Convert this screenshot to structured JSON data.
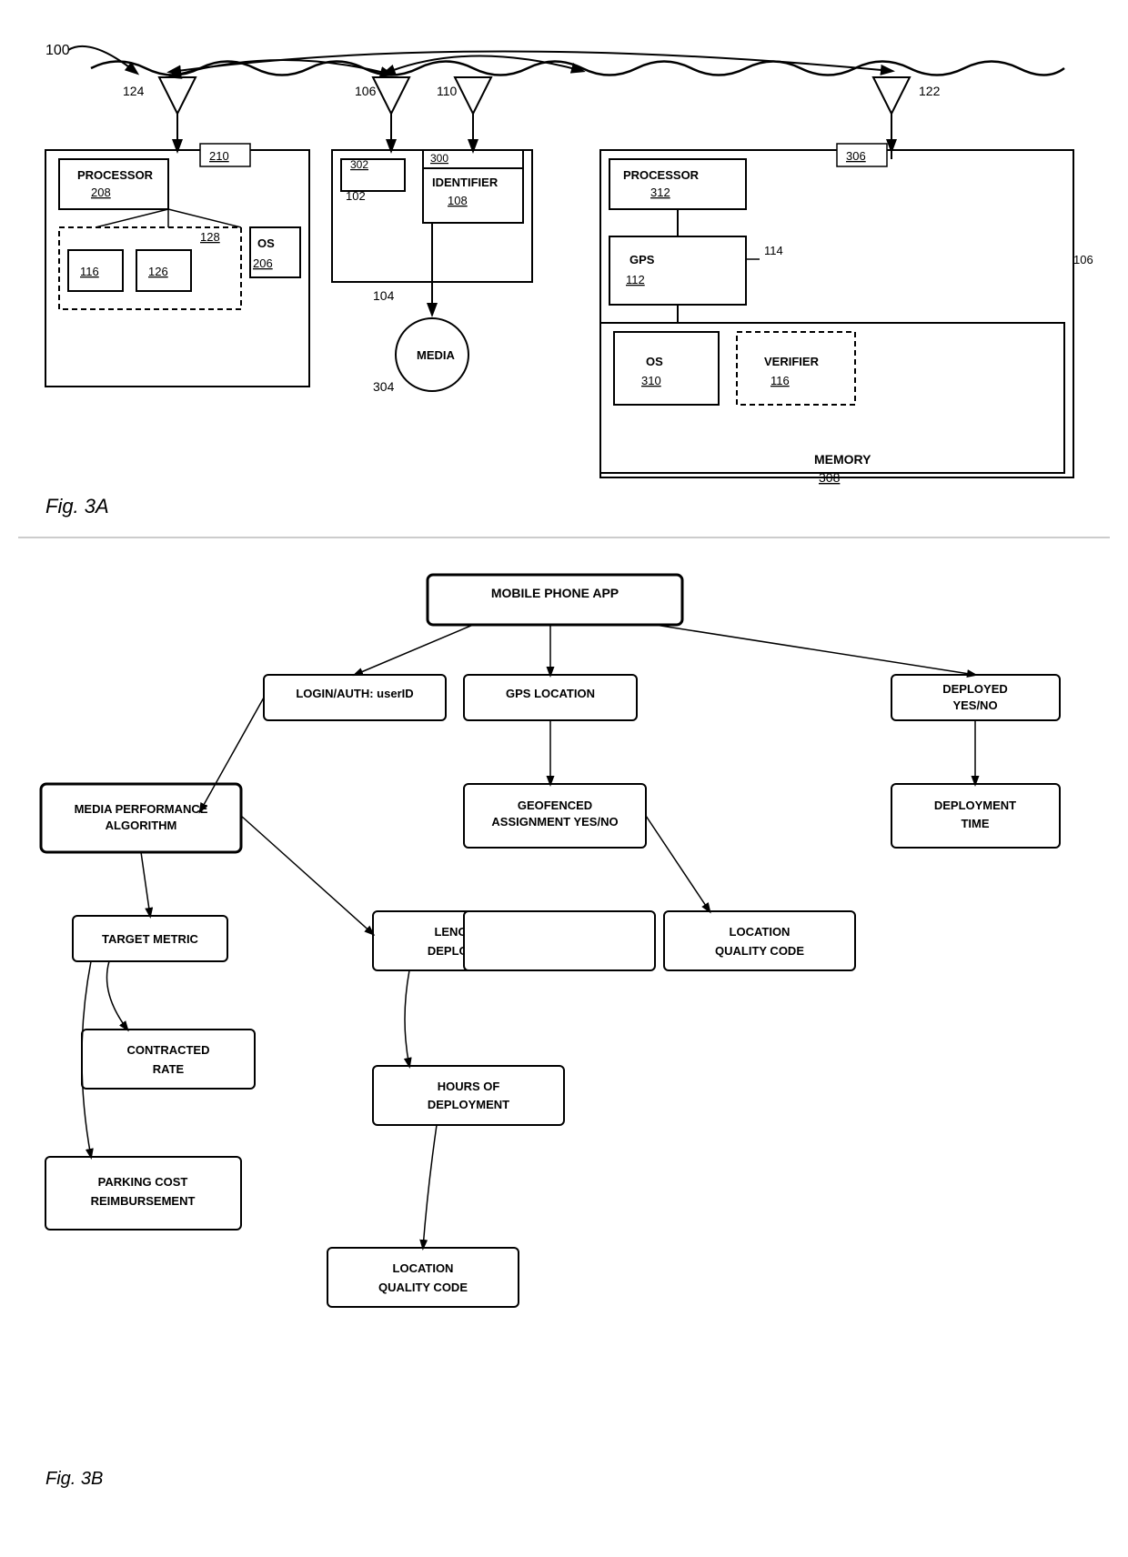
{
  "fig3a": {
    "label": "Fig. 3A",
    "ref_100": "100",
    "left_device": {
      "antenna_label": "124",
      "box_label": "210",
      "processor_label": "PROCESSOR",
      "processor_ref": "208",
      "inner_box_ref": "128",
      "os_label": "OS",
      "os_ref": "206",
      "box116": "116",
      "box126": "126"
    },
    "middle_device": {
      "antenna1_label": "106",
      "antenna2_label": "110",
      "box302_label": "302",
      "box300_label": "300",
      "identifier_label": "IDENTIFIER",
      "identifier_ref": "108",
      "ref102": "102",
      "media_label": "MEDIA",
      "media_ref": "104",
      "ref304": "304"
    },
    "right_device": {
      "antenna_label": "122",
      "box306_label": "306",
      "processor_label": "PROCESSOR",
      "processor_ref": "312",
      "gps_label": "GPS",
      "gps_ref": "112",
      "ref114": "114",
      "ref106": "106",
      "os_label": "OS",
      "os_ref": "310",
      "verifier_label": "VERIFIER",
      "verifier_ref": "116",
      "memory_label": "MEMORY",
      "memory_ref": "308"
    }
  },
  "fig3b": {
    "label": "Fig. 3B",
    "nodes": {
      "mobile_phone_app": "MOBILE PHONE APP",
      "login_auth": "LOGIN/AUTH: userID",
      "gps_location": "GPS LOCATION",
      "deployed_yes_no": "DEPLOYED YES/NO",
      "media_performance_algorithm": "MEDIA PERFORMANCE ALGORITHM",
      "geofenced_assignment": "GEOFENCED ASSIGNMENT YES/NO",
      "deployment_time": "DEPLOYMENT TIME",
      "target_metric": "TARGET METRIC",
      "length_of_deployment": "LENGTH OF DEPLOYMENT",
      "location_quality_code_top": "LOCATION QUALITY CODE",
      "contracted_rate": "CONTRACTED RATE",
      "hours_of_deployment": "HOURS OF DEPLOYMENT",
      "parking_cost_reimbursement": "PARKING COST REIMBURSEMENT",
      "location_quality_code_bottom": "LOCATION QUALITY CODE"
    }
  }
}
